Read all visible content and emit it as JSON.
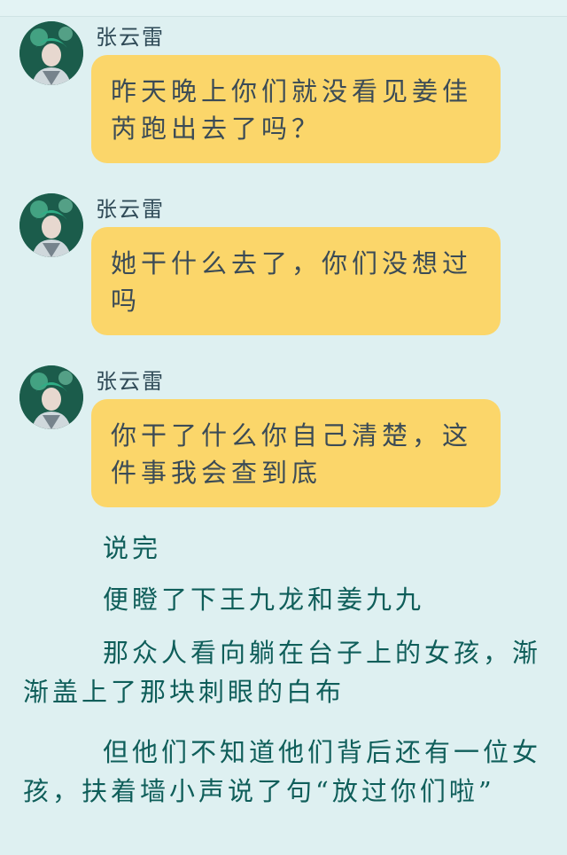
{
  "messages": [
    {
      "sender": "张云雷",
      "text": "昨天晚上你们就没看见姜佳芮跑出去了吗？"
    },
    {
      "sender": "张云雷",
      "text": "她干什么去了，你们没想过吗"
    },
    {
      "sender": "张云雷",
      "text": "你干了什么你自己清楚，这件事我会查到底"
    }
  ],
  "narration": [
    "说完",
    "便瞪了下王九龙和姜九九",
    "那众人看向躺在台子上的女孩，渐渐盖上了那块刺眼的白布",
    "但他们不知道他们背后还有一位女孩，扶着墙小声说了句“放过你们啦”"
  ],
  "colors": {
    "background": "#def0f1",
    "bubble": "#fbd66a",
    "bubble_text": "#3b4b56",
    "narration_text": "#0f5e5a",
    "sender_text": "#2f4a57"
  },
  "icons": {
    "avatar": "avatar-photo"
  }
}
